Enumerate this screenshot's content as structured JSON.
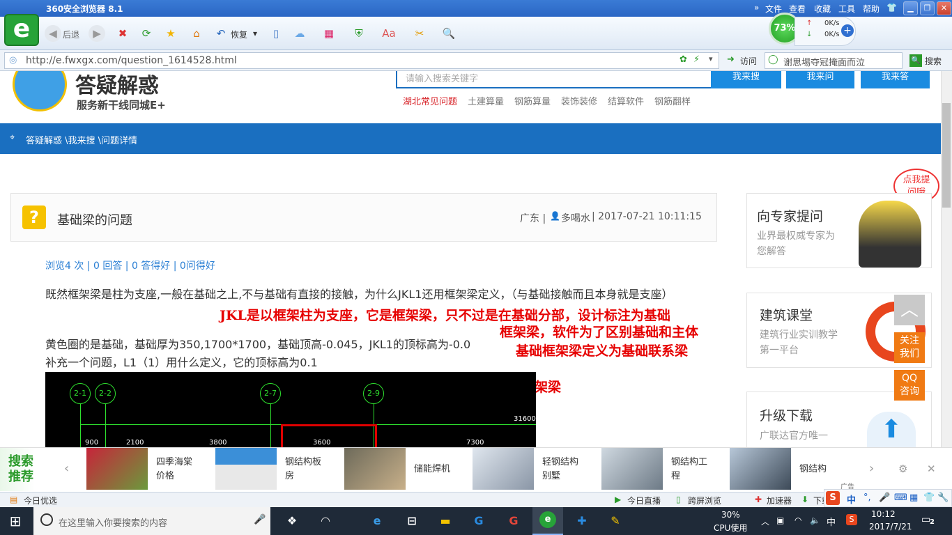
{
  "browser": {
    "title": "360安全浏览器 8.1",
    "menu": [
      "文件",
      "查看",
      "收藏",
      "工具",
      "帮助"
    ],
    "toolbar": {
      "back_label": "后退",
      "restore_label": "恢复"
    },
    "cpu_meter": "73%",
    "net_up": "0K/s",
    "net_down": "0K/s",
    "address": "http://e.fwxgx.com/question_1614528.html",
    "visit_label": "访问",
    "search_value": "谢思埸夺冠掩面而泣",
    "search_button": "搜索"
  },
  "site": {
    "logo_title": "答疑解惑",
    "logo_subtitle": "服务新干线同城E+",
    "search_placeholder": "请输入搜索关键字",
    "buttons": [
      "我来搜",
      "我来问",
      "我来答"
    ],
    "categories": [
      "湖北常见问题",
      "土建算量",
      "钢筋算量",
      "装饰装修",
      "结算软件",
      "钢筋翻样"
    ],
    "breadcrumb": "答疑解惑 \\我来搜 \\问题详情"
  },
  "question": {
    "title": "基础梁的问题",
    "meta_region": "广东 | ",
    "meta_user": "多喝水",
    "meta_time": " | 2017-07-21 10:11:15",
    "stats": "浏览4 次 | 0 回答 | 0 答得好 | 0问得好",
    "body_1": "既然框架梁是柱为支座,一般在基础之上,不与基础有直接的接触，为什么JKL1还用框架梁定义，（与基础接触而且本身就是支座）",
    "body_2": "黄色圈的是基础，基础厚为350,1700*1700，基础顶高-0.045，JKL1的顶标高为-0.0",
    "body_3": "补充一个问题，L1（1）用什么定义，它的顶标高为0.1",
    "annotation_1a": "JKL是以框架柱为支座，它是框架梁，只不过是在基础分部，设计标注为基础",
    "annotation_1b": "框架梁，软件为了区别基础和主体",
    "annotation_1c": "基础框架梁定义为基础联系梁",
    "annotation_2": "用梁定义，选择非框架梁"
  },
  "drawing": {
    "axes": [
      "2-1",
      "2-2",
      "2-7",
      "2-9"
    ],
    "dims": [
      "900",
      "2100",
      "3800",
      "3600",
      "7300"
    ],
    "total": "31600"
  },
  "sidebar": {
    "bubble": "点我提问哦",
    "expert_title": "向专家提问",
    "expert_desc": "业界最权威专家为您解答",
    "course_title": "建筑课堂",
    "course_desc": "建筑行业实训教学第一平台",
    "download_title": "升级下载",
    "download_desc": "广联达官方唯一",
    "follow": "关注我们",
    "qq": "QQ咨询"
  },
  "ad_strip": {
    "label": "搜索推荐",
    "items": [
      "四季海棠价格",
      "钢结构板房",
      "储能焊机",
      "轻钢结构别墅",
      "钢结构工程",
      "钢结构"
    ],
    "ad_badge": "广告"
  },
  "statusbar": {
    "left": "今日优选",
    "items": [
      "今日直播",
      "跨屏浏览",
      "加速器",
      "下载"
    ]
  },
  "taskbar": {
    "search_placeholder": "在这里输入你要搜索的内容",
    "cpu_percent": "30%",
    "cpu_label": "CPU使用",
    "ime": "中",
    "time": "10:12",
    "date": "2017/7/21",
    "notifications": "2"
  }
}
